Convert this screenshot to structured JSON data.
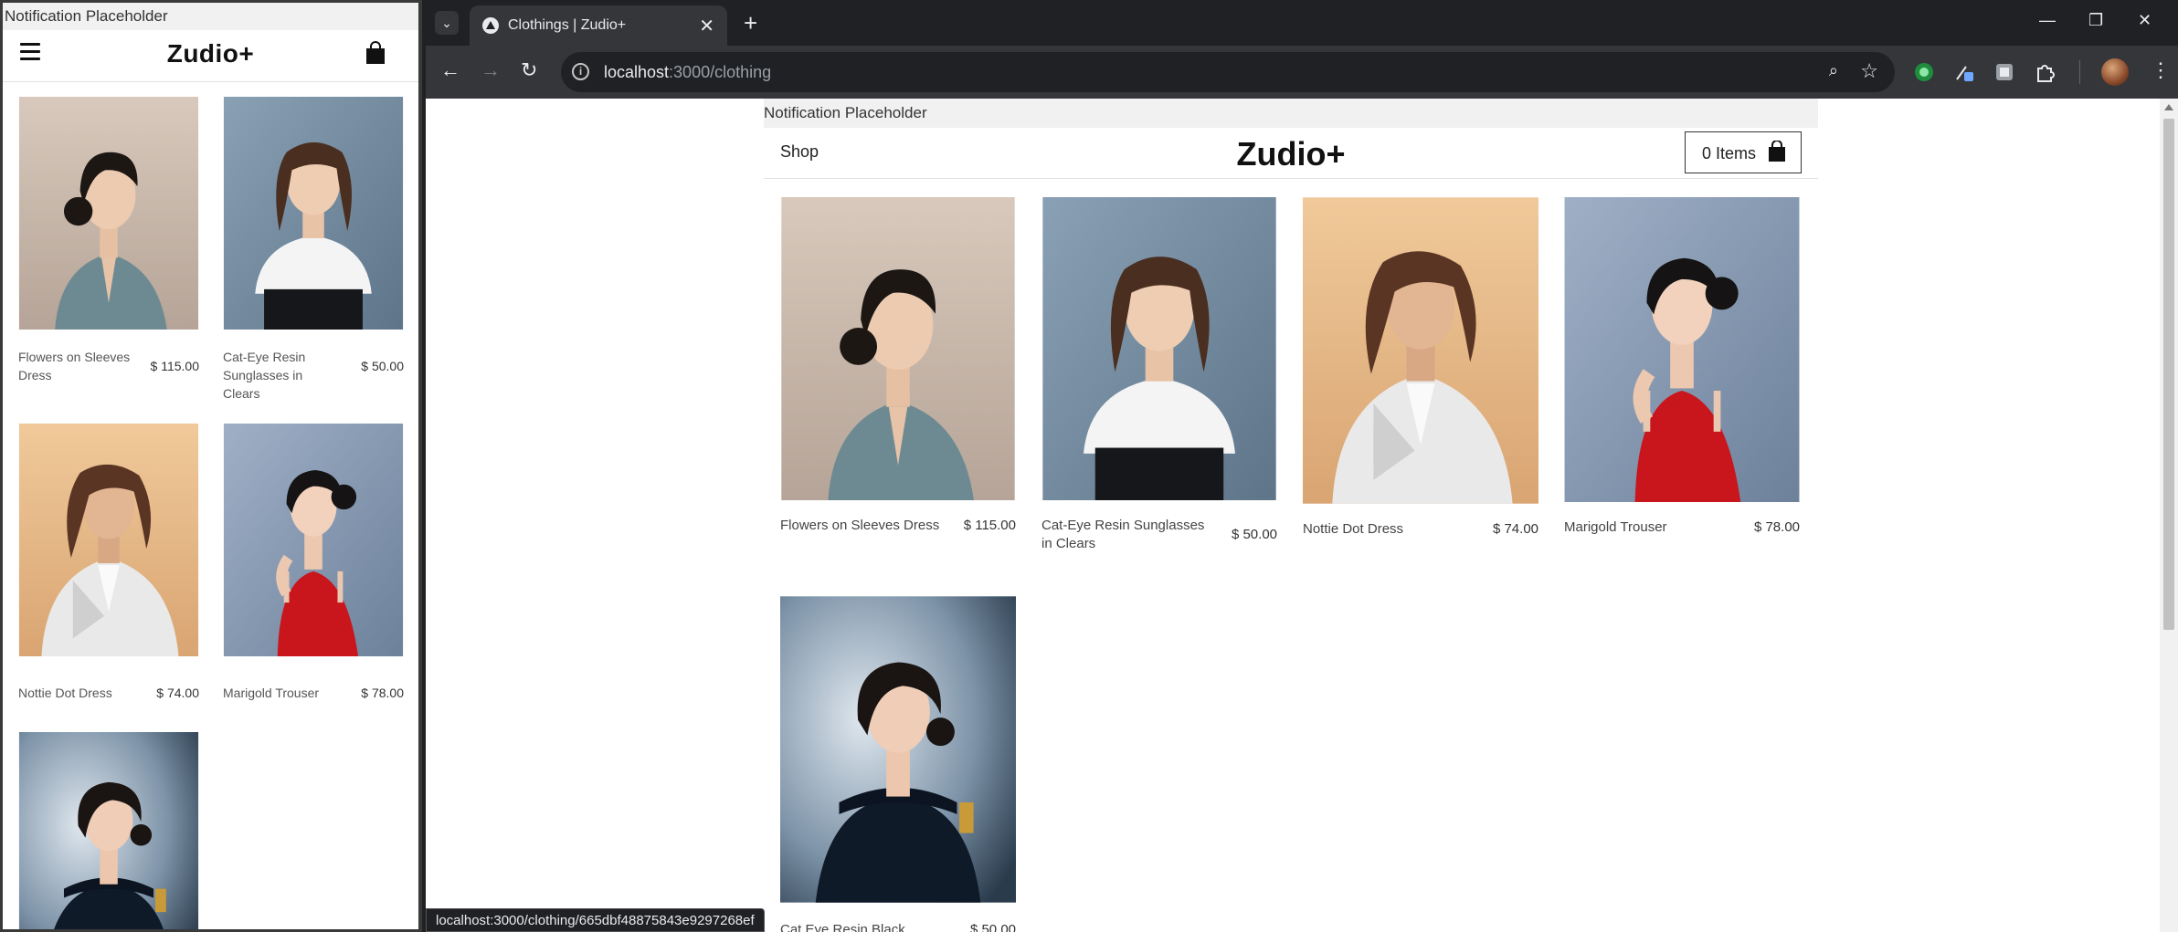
{
  "mobile": {
    "notification": "Notification Placeholder",
    "logo": "Zudio+",
    "products": [
      {
        "name": "Flowers on Sleeves Dress",
        "price": "$ 115.00"
      },
      {
        "name": "Cat-Eye Resin Sunglasses in Clears",
        "price": "$ 50.00"
      },
      {
        "name": "Nottie Dot Dress",
        "price": "$ 74.00"
      },
      {
        "name": "Marigold Trouser",
        "price": "$ 78.00"
      }
    ]
  },
  "browser": {
    "tab_title": "Clothings | Zudio+",
    "url_host": "localhost",
    "url_path": ":3000/clothing",
    "status_url": "localhost:3000/clothing/665dbf48875843e9297268ef"
  },
  "page": {
    "notification": "Notification Placeholder",
    "shop_link": "Shop",
    "logo": "Zudio+",
    "cart_label": "0 Items",
    "products": [
      {
        "name": "Flowers on Sleeves Dress",
        "price": "$ 115.00"
      },
      {
        "name": "Cat-Eye Resin Sunglasses in Clears",
        "price": "$ 50.00"
      },
      {
        "name": "Nottie Dot Dress",
        "price": "$ 74.00"
      },
      {
        "name": "Marigold Trouser",
        "price": "$ 78.00"
      },
      {
        "name": "Cat Eye Resin Black",
        "price": "$ 50.00"
      }
    ]
  },
  "icons": {
    "menu": "hamburger-icon",
    "cart": "shopping-bag-icon"
  }
}
